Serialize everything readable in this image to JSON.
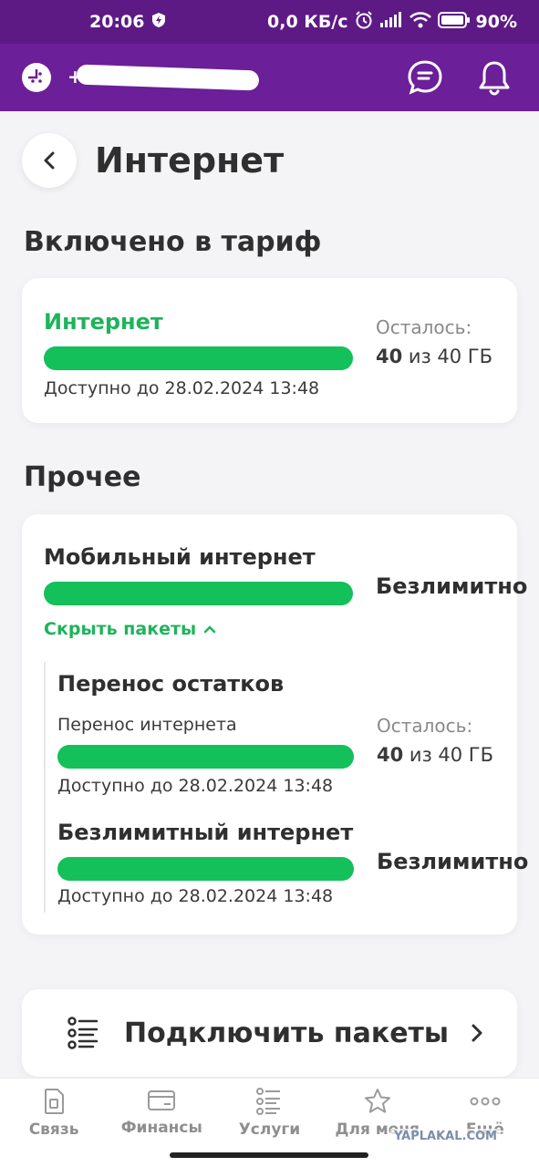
{
  "status_bar": {
    "time": "20:06",
    "network_speed": "0,0 КБ/с",
    "battery": "90%"
  },
  "header": {
    "phone_prefix": "+",
    "icons": [
      "logo-icon",
      "chat-icon",
      "bell-icon"
    ]
  },
  "page": {
    "title": "Интернет"
  },
  "included": {
    "section_title": "Включено в тариф",
    "item": {
      "name": "Интернет",
      "progress": 1.0,
      "available_until": "Доступно до 28.02.2024 13:48",
      "remain_label": "Осталось:",
      "remain_value": "40",
      "remain_total": "из 40 ГБ"
    }
  },
  "other": {
    "section_title": "Прочее",
    "mobile": {
      "name": "Мобильный интернет",
      "progress": 1.0,
      "value": "Безлимитно",
      "hide_link": "Скрыть пакеты"
    },
    "rollover": {
      "title": "Перенос остатков",
      "name": "Перенос интернета",
      "progress": 1.0,
      "available_until": "Доступно до 28.02.2024 13:48",
      "remain_label": "Осталось:",
      "remain_value": "40",
      "remain_total": "из 40 ГБ"
    },
    "unlimited": {
      "name": "Безлимитный интернет",
      "progress": 1.0,
      "value": "Безлимитно",
      "available_until": "Доступно до 28.02.2024 13:48"
    }
  },
  "connect": {
    "label": "Подключить пакеты"
  },
  "bottom_nav": {
    "items": [
      {
        "label": "Связь",
        "icon": "sim-icon"
      },
      {
        "label": "Финансы",
        "icon": "card-icon"
      },
      {
        "label": "Услуги",
        "icon": "list-icon"
      },
      {
        "label": "Для меня",
        "icon": "star-icon"
      },
      {
        "label": "Ещё",
        "icon": "more-icon"
      }
    ]
  },
  "watermark": "YAPLAKAL.COM",
  "colors": {
    "brand_purple": "#6b1f98",
    "accent_green": "#13c05a",
    "text_green": "#1fb35b"
  }
}
